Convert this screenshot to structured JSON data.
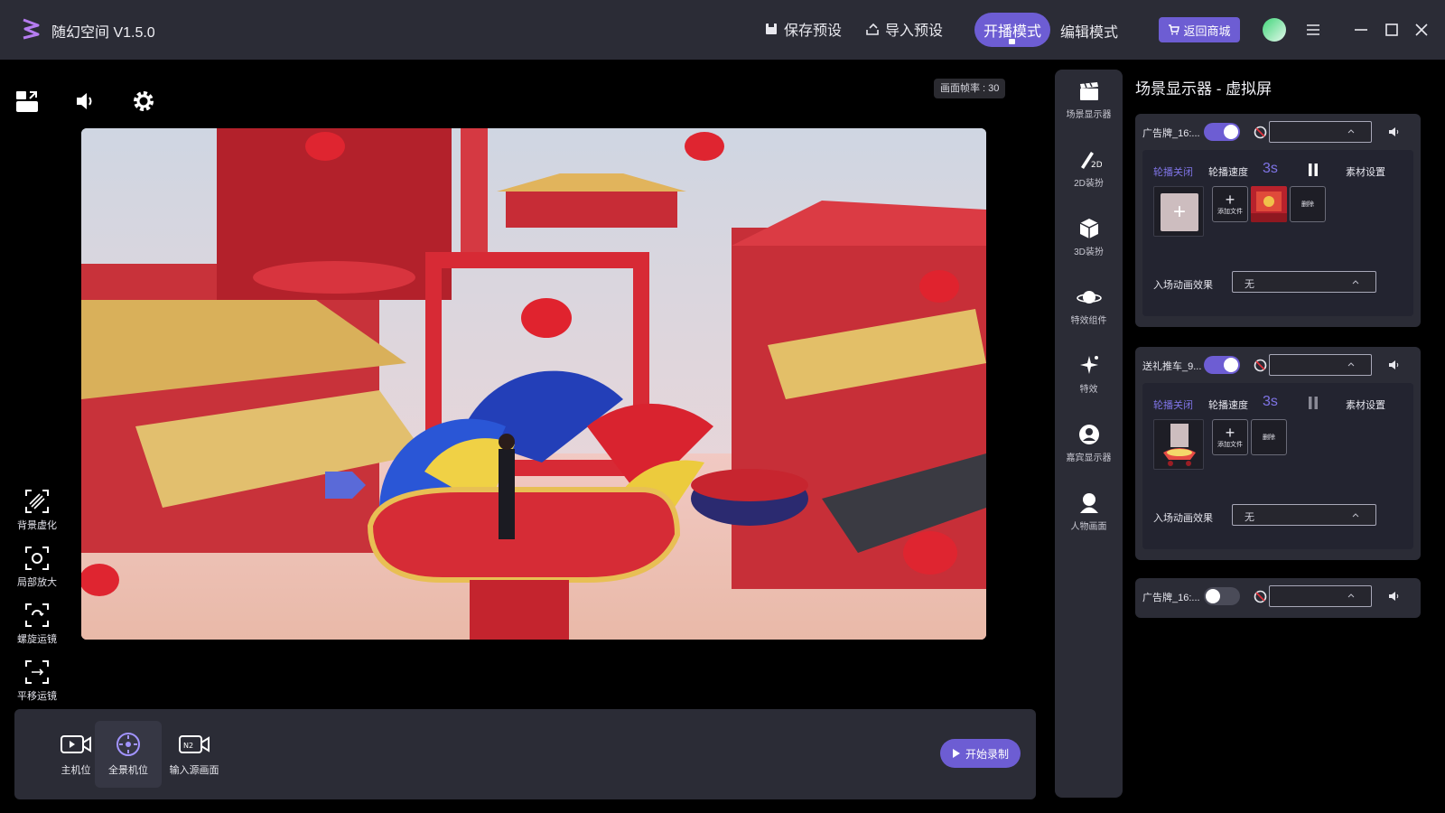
{
  "app": {
    "title": "随幻空间 V1.5.0",
    "accent": "#6d5dd3"
  },
  "header": {
    "save_preset": "保存预设",
    "import_preset": "导入预设",
    "mode_live": "开播模式",
    "mode_edit": "编辑模式",
    "back_to_store": "返回商城"
  },
  "preview": {
    "fps_label": "画面帧率 : 30"
  },
  "camera_tools": [
    {
      "label": "背景虚化",
      "icon": "background-blur-icon"
    },
    {
      "label": "局部放大",
      "icon": "zoom-focus-icon"
    },
    {
      "label": "螺旋运镜",
      "icon": "spiral-camera-icon"
    },
    {
      "label": "平移运镜",
      "icon": "pan-camera-icon"
    }
  ],
  "bottom_bar": {
    "cameras": [
      {
        "label": "主机位",
        "active": false
      },
      {
        "label": "全景机位",
        "active": true
      },
      {
        "label": "输入源画面",
        "active": false
      }
    ],
    "record": "开始录制"
  },
  "sidenav": [
    {
      "label": "场景显示器",
      "icon": "clapper-icon"
    },
    {
      "label": "2D装扮",
      "icon": "brush-2d-icon"
    },
    {
      "label": "3D装扮",
      "icon": "cube-3d-icon"
    },
    {
      "label": "特效组件",
      "icon": "planet-icon"
    },
    {
      "label": "特效",
      "icon": "sparkle-icon"
    },
    {
      "label": "嘉宾显示器",
      "icon": "guest-icon"
    },
    {
      "label": "人物画面",
      "icon": "person-icon"
    }
  ],
  "panel": {
    "title": "场景显示器 - 虚拟屏",
    "cards": [
      {
        "name": "广告牌_16:...",
        "enabled": true,
        "expanded": true,
        "rotation": "轮播关闭",
        "speed_label": "轮播速度",
        "speed": "3s",
        "material": "素材设置",
        "add_file": "添加文件",
        "delete": "删除",
        "anim_label": "入场动画效果",
        "anim_value": "无"
      },
      {
        "name": "送礼推车_9...",
        "enabled": true,
        "expanded": true,
        "rotation": "轮播关闭",
        "speed_label": "轮播速度",
        "speed": "3s",
        "material": "素材设置",
        "add_file": "添加文件",
        "delete": "删除",
        "anim_label": "入场动画效果",
        "anim_value": "无"
      },
      {
        "name": "广告牌_16:...",
        "enabled": false,
        "expanded": false
      }
    ]
  }
}
